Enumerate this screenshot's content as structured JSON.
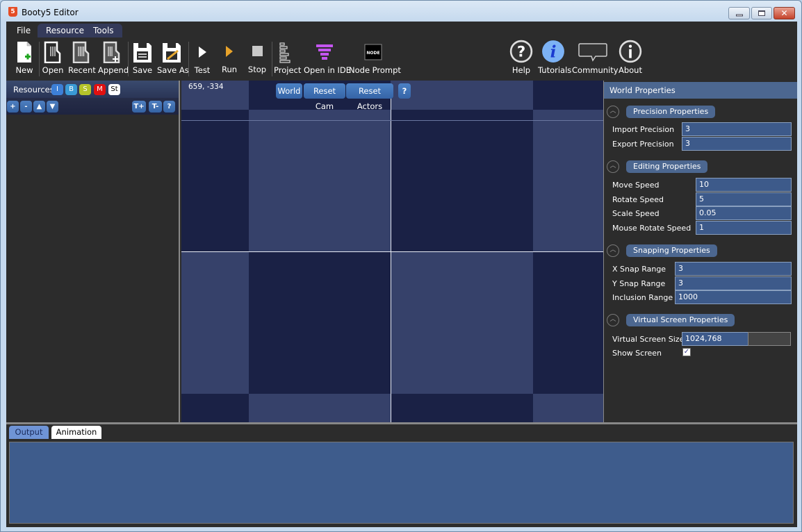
{
  "window": {
    "title": "Booty5 Editor",
    "icon": "html5-icon",
    "controls": {
      "minimize": "minimize-icon",
      "maximize": "maximize-icon",
      "close": "✕"
    }
  },
  "menu": {
    "items": [
      {
        "label": "File"
      },
      {
        "label": "Resource"
      },
      {
        "label": "Tools"
      }
    ]
  },
  "toolbar": {
    "items": [
      {
        "label": "New",
        "icon": "new-file-icon"
      },
      {
        "label": "Open",
        "icon": "open-icon"
      },
      {
        "label": "Recent",
        "icon": "recent-icon"
      },
      {
        "label": "Append",
        "icon": "append-icon"
      },
      {
        "label": "Save",
        "icon": "save-icon"
      },
      {
        "label": "Save As",
        "icon": "save-as-icon"
      },
      {
        "label": "Test",
        "icon": "test-play-icon"
      },
      {
        "label": "Run",
        "icon": "run-play-icon"
      },
      {
        "label": "Stop",
        "icon": "stop-icon"
      },
      {
        "label": "Project",
        "icon": "project-icon"
      },
      {
        "label": "Open in IDE",
        "icon": "ide-icon"
      },
      {
        "label": "Node Prompt",
        "icon": "node-icon",
        "icon_text": "NODE"
      },
      {
        "label": "Help",
        "icon": "help-icon",
        "icon_text": "?"
      },
      {
        "label": "Tutorials",
        "icon": "tutorials-icon",
        "icon_text": "i"
      },
      {
        "label": "Community",
        "icon": "community-icon"
      },
      {
        "label": "About",
        "icon": "about-icon",
        "icon_text": "i"
      }
    ]
  },
  "resources": {
    "title": "Resources",
    "filters": [
      {
        "label": "I",
        "color": "#3d7fd6"
      },
      {
        "label": "B",
        "color": "#3a9ad6"
      },
      {
        "label": "S",
        "color": "#b5c42a"
      },
      {
        "label": "M",
        "color": "#e01010"
      },
      {
        "label": "St",
        "color": "#ffffff"
      }
    ],
    "tools": [
      "+",
      "-",
      "▲",
      "▼"
    ],
    "tools_right": [
      "T+",
      "T-",
      "?"
    ]
  },
  "viewport": {
    "coords": "659, -334",
    "buttons": [
      "World",
      "Reset Cam",
      "Reset Actors",
      "?"
    ]
  },
  "properties": {
    "title": "World Properties",
    "sections": [
      {
        "title": "Precision Properties",
        "fields": [
          {
            "label": "Import Precision",
            "value": "3"
          },
          {
            "label": "Export Precision",
            "value": "3"
          }
        ]
      },
      {
        "title": "Editing Properties",
        "fields": [
          {
            "label": "Move Speed",
            "value": "10"
          },
          {
            "label": "Rotate Speed",
            "value": "5"
          },
          {
            "label": "Scale Speed",
            "value": "0.05"
          },
          {
            "label": "Mouse Rotate Speed",
            "value": "1"
          }
        ]
      },
      {
        "title": "Snapping Properties",
        "fields": [
          {
            "label": "X Snap Range",
            "value": "3"
          },
          {
            "label": "Y Snap Range",
            "value": "3"
          },
          {
            "label": "Inclusion Range",
            "value": "1000"
          }
        ]
      },
      {
        "title": "Virtual Screen Properties",
        "fields": [
          {
            "label": "Virtual Screen Size",
            "value": "1024,768"
          },
          {
            "label": "Show Screen",
            "checked": true,
            "check_glyph": "✓"
          }
        ]
      }
    ],
    "toggle_glyph": "︿"
  },
  "bottom": {
    "tabs": [
      {
        "label": "Output",
        "active": true
      },
      {
        "label": "Animation",
        "active": false
      }
    ]
  }
}
